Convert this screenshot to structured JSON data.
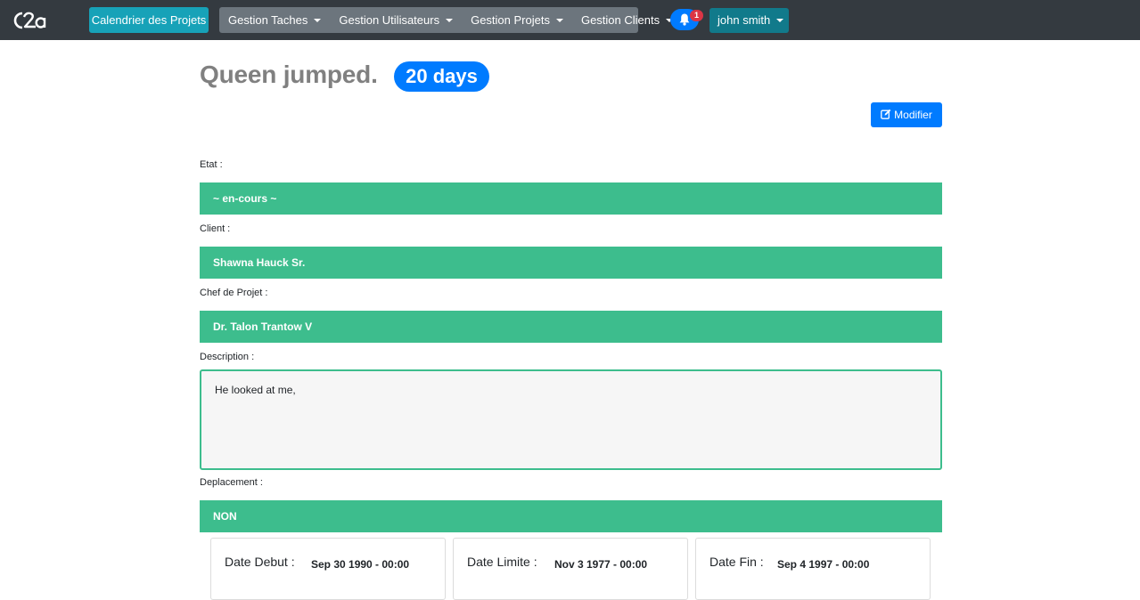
{
  "navbar": {
    "logo_text": "C2a",
    "calendar_label": "Calendrier des Projets",
    "menus": [
      "Gestion Taches",
      "Gestion Utilisateurs",
      "Gestion Projets",
      "Gestion Clients"
    ],
    "notification_count": "1",
    "user_name": "john smith"
  },
  "page": {
    "title": "Queen jumped.",
    "days_badge": "20 days",
    "edit_label": "Modifier"
  },
  "fields": {
    "etat_label": "Etat :",
    "etat_value": "~ en-cours ~",
    "client_label": "Client :",
    "client_value": "Shawna Hauck Sr.",
    "chef_label": "Chef de Projet :",
    "chef_value": "Dr. Talon Trantow V",
    "description_label": "Description :",
    "description_value": "He looked at me,",
    "deplacement_label": "Deplacement :",
    "deplacement_value": "NON"
  },
  "dates": {
    "debut_label": "Date Debut :",
    "debut_value": "Sep 30 1990 - 00:00",
    "limite_label": "Date Limite :",
    "limite_value": "Nov 3 1977 - 00:00",
    "fin_label": "Date Fin :",
    "fin_value": "Sep 4 1997 - 00:00"
  },
  "colors": {
    "navbar": "#343a40",
    "accent_green": "#3dbd8d",
    "primary": "#007bff",
    "info": "#17a2b8"
  },
  "icons": [
    "c2a-logo",
    "bell-icon",
    "edit-icon",
    "chevron-down-icon"
  ]
}
